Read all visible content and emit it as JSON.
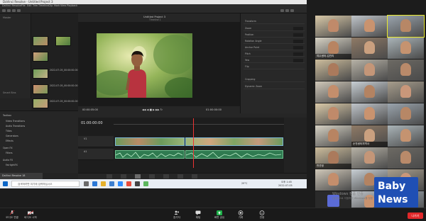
{
  "resolve": {
    "window_title": "DaVinci Resolve - Untitled Project 3",
    "project_title": "Untitled Project 3",
    "viewer_subtitle": "Timeline 1",
    "timecode_main": "01:00:00:00",
    "timecode_left": "00:00:05:00",
    "timecode_right": "01:00:00:00",
    "menu": [
      "DaVinci Resolve",
      "File",
      "Edit",
      "Trim",
      "Timeline",
      "Clip",
      "Mark",
      "View",
      "Playback",
      "Fusion",
      "Color",
      "Fairlight",
      "Workspace",
      "Help"
    ],
    "media_pool_labels": [
      "Master",
      "Smart Bins"
    ],
    "thumbnails": [
      {
        "label": "2022-07-05_00:00:00.00"
      },
      {
        "label": "2022-07-05_00:00:00.00"
      },
      {
        "label": "2022-07-05_00:00:00.00"
      }
    ],
    "effects": [
      "Toolbox",
      "Video Transitions",
      "Audio Transitions",
      "Titles",
      "Generators",
      "Effects",
      "Open FX",
      "Filters",
      "Audio FX",
      "FairlightFX"
    ],
    "tracks": [
      {
        "label": "V1",
        "name": "Video 1"
      },
      {
        "label": "A1",
        "name": "Audio 1"
      }
    ],
    "inspector_rows": [
      "Transform",
      "Zoom",
      "Position",
      "Rotation Angle",
      "Anchor Point",
      "Pitch",
      "Yaw",
      "Flip",
      "Cropping",
      "Dynamic Zoom"
    ]
  },
  "popup": {
    "text": "DaVinci Resolve 18"
  },
  "taskbar": {
    "search_placeholder": "검색하려면 여기에 입력하십시오",
    "temp": "29°C",
    "time": "오후 1:45",
    "date": "2022-07-05"
  },
  "participants": [
    {
      "name": "",
      "camera": true
    },
    {
      "name": "",
      "camera": true
    },
    {
      "name": "",
      "camera": true,
      "active": true
    },
    {
      "name": "여수센터-김진리",
      "camera": true
    },
    {
      "name": "",
      "camera": true
    },
    {
      "name": "",
      "camera": true
    },
    {
      "name": "",
      "camera": true
    },
    {
      "name": "",
      "camera": true
    },
    {
      "name": "",
      "camera": true
    },
    {
      "name": "",
      "camera": true
    },
    {
      "name": "",
      "camera": true
    },
    {
      "name": "",
      "camera": true
    },
    {
      "name": "",
      "camera": true
    },
    {
      "name": "",
      "camera": true
    },
    {
      "name": "",
      "camera": true
    },
    {
      "name": "",
      "camera": true
    },
    {
      "name": "순천센터지역사",
      "camera": true
    },
    {
      "name": "",
      "camera": true
    },
    {
      "name": "반관정",
      "camera": true
    },
    {
      "name": "",
      "camera": true
    },
    {
      "name": "",
      "camera": true
    },
    {
      "name": "",
      "camera": true
    },
    {
      "name": "",
      "camera": true
    },
    {
      "name": "",
      "camera": true
    },
    {
      "name": "",
      "camera": false
    },
    {
      "name": "",
      "camera": true
    },
    {
      "name": "",
      "camera": true
    }
  ],
  "watermark": {
    "line1": "Windows 정품 인증",
    "line2": "[설정]으로 이동하여 Windows를 정품 인증합니다."
  },
  "logo": {
    "line1": "Baby",
    "line2": "News"
  },
  "zoom_controls": [
    {
      "label": "오디오 연결",
      "icon": "mic-icon"
    },
    {
      "label": "비디오 시작",
      "icon": "camera-icon"
    },
    {
      "label": "참가자",
      "icon": "participants-icon"
    },
    {
      "label": "채팅",
      "icon": "chat-icon"
    },
    {
      "label": "화면 공유",
      "icon": "share-icon"
    },
    {
      "label": "기록",
      "icon": "record-icon"
    },
    {
      "label": "반응",
      "icon": "reactions-icon"
    }
  ],
  "leave_label": "나가기",
  "colors": {
    "accent": "#1fb24a",
    "leave": "#e0282a",
    "active_speaker": "#e8e82a"
  }
}
